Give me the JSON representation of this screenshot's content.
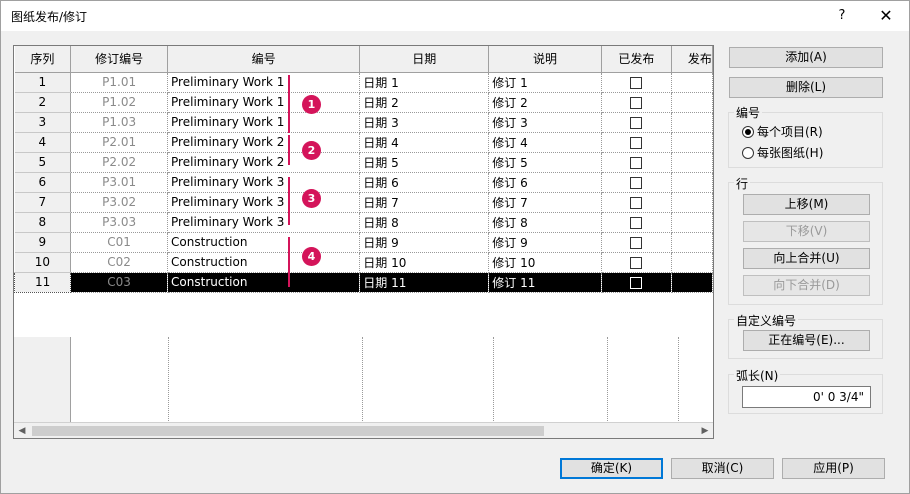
{
  "window": {
    "title": "图纸发布/修订",
    "help": "?",
    "close": "✕"
  },
  "grid": {
    "headers": [
      "序列",
      "修订编号",
      "编号",
      "日期",
      "说明",
      "已发布",
      "发布"
    ],
    "rows": [
      {
        "seq": "1",
        "rev": "P1.01",
        "num": "Preliminary Work 1",
        "date": "日期 1",
        "desc": "修订 1"
      },
      {
        "seq": "2",
        "rev": "P1.02",
        "num": "Preliminary Work 1",
        "date": "日期 2",
        "desc": "修订 2"
      },
      {
        "seq": "3",
        "rev": "P1.03",
        "num": "Preliminary Work 1",
        "date": "日期 3",
        "desc": "修订 3"
      },
      {
        "seq": "4",
        "rev": "P2.01",
        "num": "Preliminary Work 2",
        "date": "日期 4",
        "desc": "修订 4"
      },
      {
        "seq": "5",
        "rev": "P2.02",
        "num": "Preliminary Work 2",
        "date": "日期 5",
        "desc": "修订 5"
      },
      {
        "seq": "6",
        "rev": "P3.01",
        "num": "Preliminary Work 3",
        "date": "日期 6",
        "desc": "修订 6"
      },
      {
        "seq": "7",
        "rev": "P3.02",
        "num": "Preliminary Work 3",
        "date": "日期 7",
        "desc": "修订 7"
      },
      {
        "seq": "8",
        "rev": "P3.03",
        "num": "Preliminary Work 3",
        "date": "日期 8",
        "desc": "修订 8"
      },
      {
        "seq": "9",
        "rev": "C01",
        "num": "Construction",
        "date": "日期 9",
        "desc": "修订 9"
      },
      {
        "seq": "10",
        "rev": "C02",
        "num": "Construction",
        "date": "日期 10",
        "desc": "修订 10"
      },
      {
        "seq": "11",
        "rev": "C03",
        "num": "Construction",
        "date": "日期 11",
        "desc": "修订 11"
      }
    ],
    "selected_row": 11,
    "scroll_left": "◀",
    "scroll_right": "▶"
  },
  "annotations": {
    "badges": [
      "1",
      "2",
      "3",
      "4"
    ],
    "accent": "#d4145a"
  },
  "buttons": {
    "add": "添加(A)",
    "delete": "删除(L)"
  },
  "numbering": {
    "label": "编号",
    "per_project": "每个项目(R)",
    "per_sheet": "每张图纸(H)",
    "selected": "per_project"
  },
  "row_group": {
    "label": "行",
    "move_up": "上移(M)",
    "move_down": "下移(V)",
    "merge_up": "向上合并(U)",
    "merge_down": "向下合并(D)"
  },
  "custom_numbering": {
    "label": "自定义编号",
    "button": "正在编号(E)..."
  },
  "arc_length": {
    "label": "弧长(N)",
    "value": "0'  0 3/4\""
  },
  "footer": {
    "ok": "确定(K)",
    "cancel": "取消(C)",
    "apply": "应用(P)"
  }
}
